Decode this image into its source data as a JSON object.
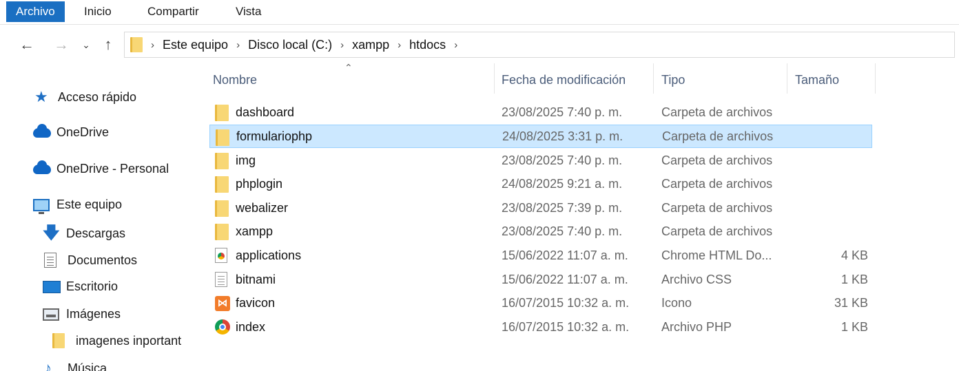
{
  "ribbon": {
    "tabs": [
      {
        "label": "Archivo",
        "active": true
      },
      {
        "label": "Inicio",
        "active": false
      },
      {
        "label": "Compartir",
        "active": false
      },
      {
        "label": "Vista",
        "active": false
      }
    ]
  },
  "nav": {
    "back_icon": "arrow-left-icon",
    "forward_icon": "arrow-right-icon",
    "recent_icon": "chevron-down-icon",
    "up_icon": "arrow-up-icon",
    "breadcrumb": [
      "Este equipo",
      "Disco local (C:)",
      "xampp",
      "htdocs"
    ]
  },
  "sidebar": {
    "items": [
      {
        "label": "Acceso rápido",
        "icon": "star-icon"
      },
      {
        "label": "OneDrive",
        "icon": "cloud-icon"
      },
      {
        "label": "OneDrive - Personal",
        "icon": "cloud-icon"
      },
      {
        "label": "Este equipo",
        "icon": "computer-icon"
      },
      {
        "label": "Descargas",
        "icon": "download-icon"
      },
      {
        "label": "Documentos",
        "icon": "document-icon"
      },
      {
        "label": "Escritorio",
        "icon": "desktop-icon"
      },
      {
        "label": "Imágenes",
        "icon": "images-icon"
      },
      {
        "label": "imagenes inportant",
        "icon": "folder-icon"
      },
      {
        "label": "Música",
        "icon": "music-icon"
      }
    ]
  },
  "columns": {
    "name": "Nombre",
    "date": "Fecha de modificación",
    "type": "Tipo",
    "size": "Tamaño"
  },
  "files": [
    {
      "name": "dashboard",
      "date": "23/08/2025 7:40 p. m.",
      "type": "Carpeta de archivos",
      "size": "",
      "icon": "folder-icon"
    },
    {
      "name": "formulariophp",
      "date": "24/08/2025 3:31 p. m.",
      "type": "Carpeta de archivos",
      "size": "",
      "icon": "folder-icon",
      "selected": true
    },
    {
      "name": "img",
      "date": "23/08/2025 7:40 p. m.",
      "type": "Carpeta de archivos",
      "size": "",
      "icon": "folder-icon"
    },
    {
      "name": "phplogin",
      "date": "24/08/2025 9:21 a. m.",
      "type": "Carpeta de archivos",
      "size": "",
      "icon": "folder-icon"
    },
    {
      "name": "webalizer",
      "date": "23/08/2025 7:39 p. m.",
      "type": "Carpeta de archivos",
      "size": "",
      "icon": "folder-icon"
    },
    {
      "name": "xampp",
      "date": "23/08/2025 7:40 p. m.",
      "type": "Carpeta de archivos",
      "size": "",
      "icon": "folder-icon"
    },
    {
      "name": "applications",
      "date": "15/06/2022 11:07 a. m.",
      "type": "Chrome HTML Do...",
      "size": "4 KB",
      "icon": "chrome-html-file-icon"
    },
    {
      "name": "bitnami",
      "date": "15/06/2022 11:07 a. m.",
      "type": "Archivo CSS",
      "size": "1 KB",
      "icon": "css-file-icon"
    },
    {
      "name": "favicon",
      "date": "16/07/2015 10:32 a. m.",
      "type": "Icono",
      "size": "31 KB",
      "icon": "xampp-icon"
    },
    {
      "name": "index",
      "date": "16/07/2015 10:32 a. m.",
      "type": "Archivo PHP",
      "size": "1 KB",
      "icon": "chrome-icon"
    }
  ],
  "colors": {
    "accent": "#1a6fc2",
    "selection": "#cce8ff",
    "selection_border": "#99d1ff",
    "header_text": "#4b5d7a"
  }
}
